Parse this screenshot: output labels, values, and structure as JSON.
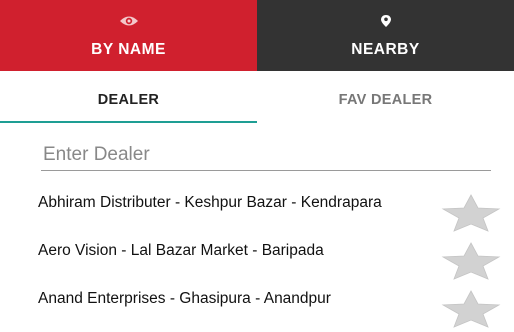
{
  "top_tabs": [
    {
      "label": "BY NAME",
      "icon": "eye-icon",
      "active": true
    },
    {
      "label": "NEARBY",
      "icon": "location-pin-icon",
      "active": false
    }
  ],
  "sub_tabs": [
    {
      "label": "DEALER",
      "active": true
    },
    {
      "label": "FAV DEALER",
      "active": false
    }
  ],
  "search": {
    "placeholder": "Enter Dealer",
    "value": ""
  },
  "dealers": [
    {
      "name": "Abhiram Distributer - Keshpur Bazar - Kendrapara",
      "favorite": false
    },
    {
      "name": "Aero Vision - Lal Bazar Market - Baripada",
      "favorite": false
    },
    {
      "name": "Anand Enterprises - Ghasipura - Anandpur",
      "favorite": false
    }
  ],
  "colors": {
    "accent_red": "#d0202e",
    "dark_tab": "#333333",
    "tab_indicator": "#1e9e94",
    "star_gray": "#d2d2d2"
  }
}
